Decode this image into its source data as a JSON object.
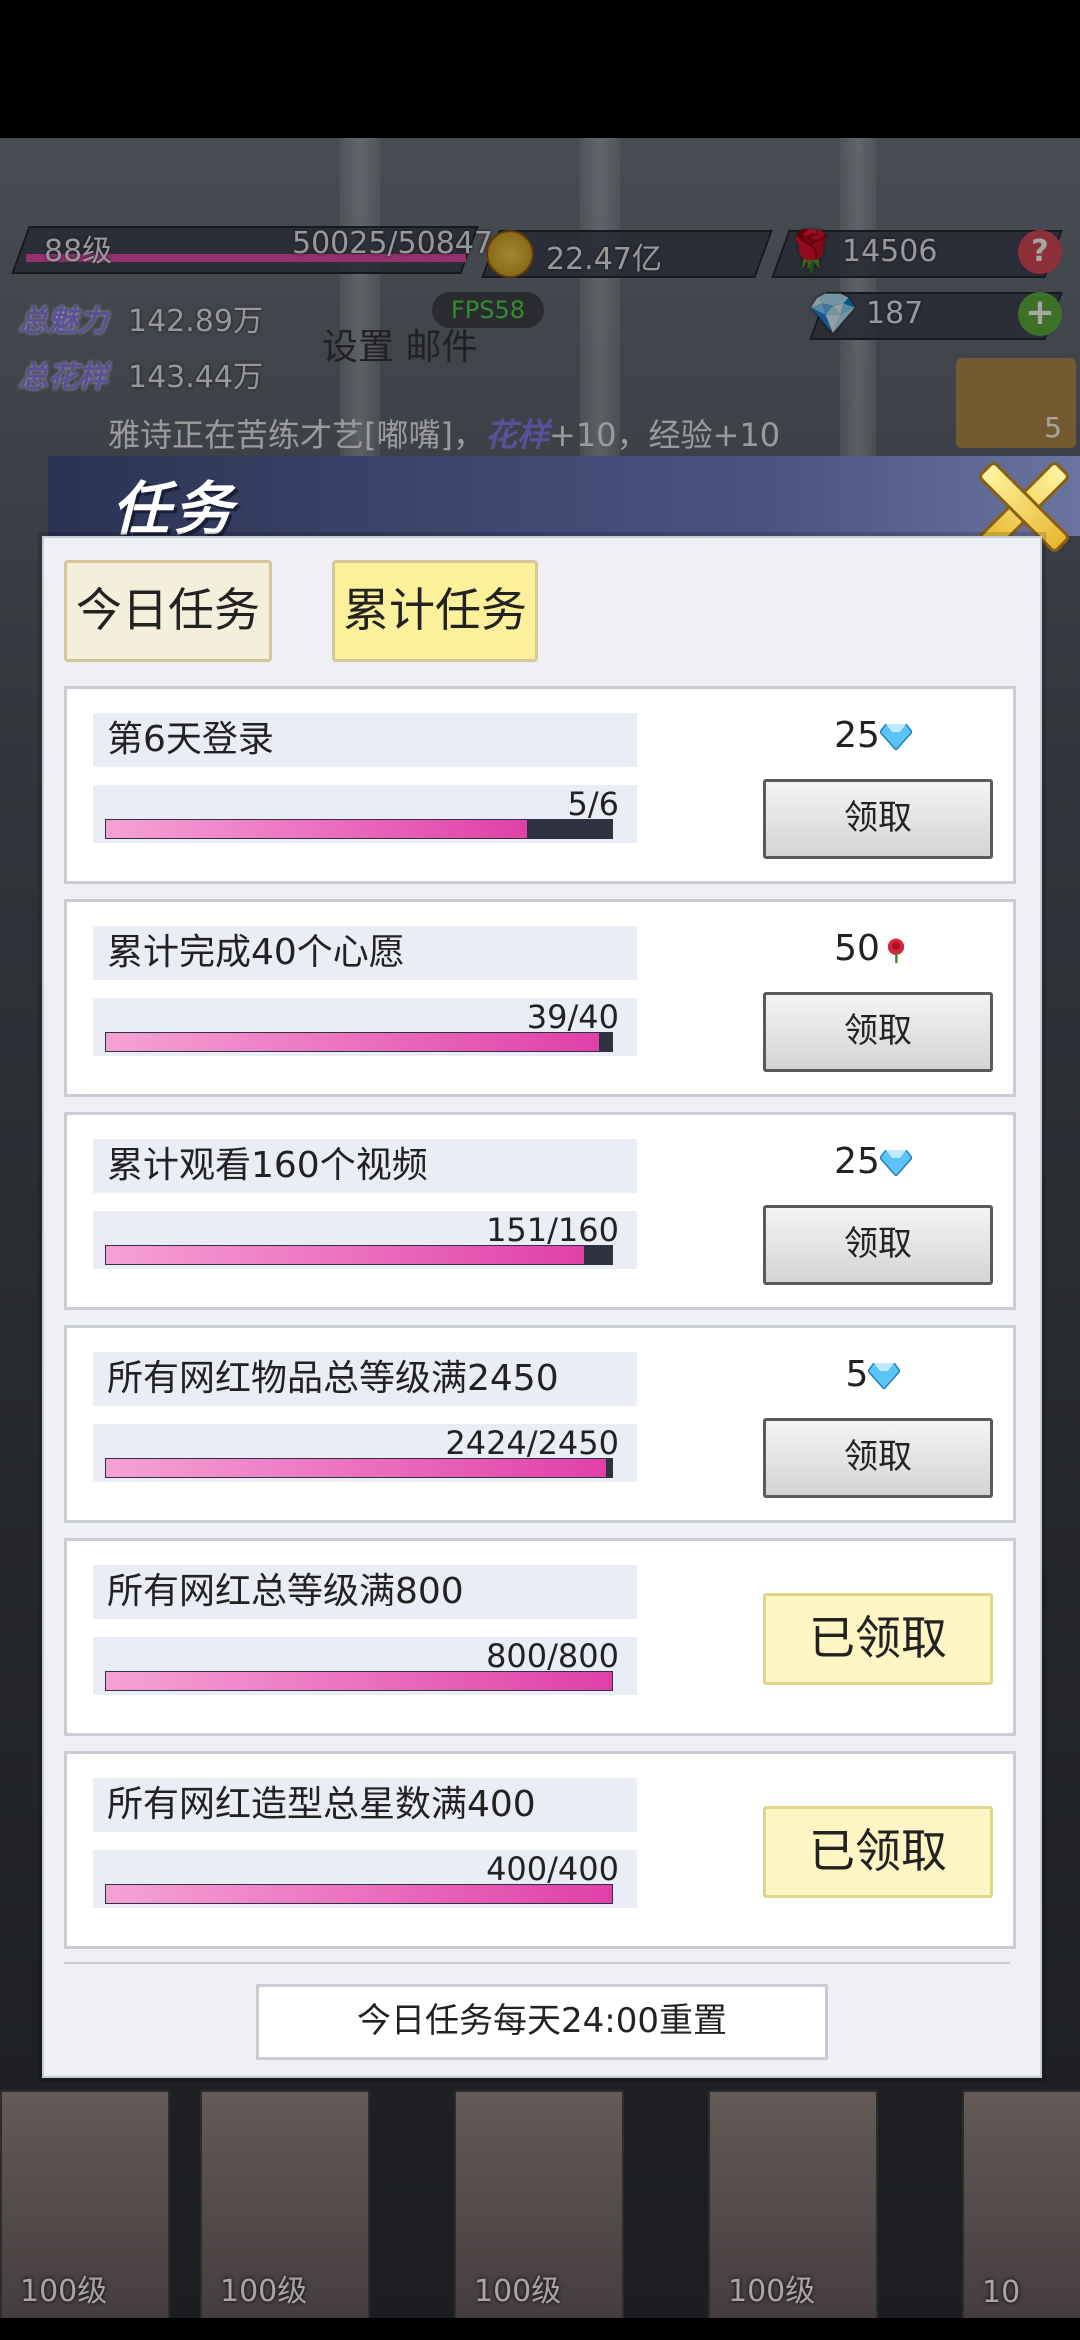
{
  "hud": {
    "level": "88级",
    "exp": "50025/50847",
    "exp_fraction": 0.98,
    "coins": "22.47亿",
    "roses": "14506",
    "diamonds": "187",
    "charm_label": "总魅力",
    "charm_value": "142.89万",
    "style_label": "总花样",
    "style_value": "143.44万",
    "settings_mail": "设置 邮件",
    "fps": "FPS58",
    "help_icon": "?",
    "plus_icon": "+",
    "ticker_prefix": "雅诗正在苦练才艺[嘟嘴]，",
    "ticker_highlight": "花样",
    "ticker_suffix": "+10，经验+10",
    "rank_badge": "5"
  },
  "panel": {
    "title": "任务",
    "tabs": [
      {
        "label": "今日任务",
        "active": false
      },
      {
        "label": "累计任务",
        "active": true
      }
    ],
    "tasks": [
      {
        "name": "第6天登录",
        "progress_text": "5/6",
        "progress": 0.833,
        "reward_amount": "25",
        "reward_icon": "diamond-icon",
        "status": "claimable",
        "button": "领取"
      },
      {
        "name": "累计完成40个心愿",
        "progress_text": "39/40",
        "progress": 0.975,
        "reward_amount": "50",
        "reward_icon": "rose-icon",
        "status": "claimable",
        "button": "领取"
      },
      {
        "name": "累计观看160个视频",
        "progress_text": "151/160",
        "progress": 0.944,
        "reward_amount": "25",
        "reward_icon": "diamond-icon",
        "status": "claimable",
        "button": "领取"
      },
      {
        "name": "所有网红物品总等级满2450",
        "progress_text": "2424/2450",
        "progress": 0.989,
        "reward_amount": "5",
        "reward_icon": "diamond-icon",
        "status": "claimable",
        "button": "领取"
      },
      {
        "name": "所有网红总等级满800",
        "progress_text": "800/800",
        "progress": 1.0,
        "status": "claimed",
        "button": "已领取"
      },
      {
        "name": "所有网红造型总星数满400",
        "progress_text": "400/400",
        "progress": 1.0,
        "status": "claimed",
        "button": "已领取"
      }
    ],
    "reset_note": "今日任务每天24:00重置"
  },
  "characters": [
    {
      "level": "100级"
    },
    {
      "level": "100级"
    },
    {
      "level": "100级"
    },
    {
      "level": "100级"
    },
    {
      "level": "10"
    }
  ],
  "colors": {
    "progress_fill": "#e040a8",
    "tab_active": "#fdf09a",
    "claimed_bg": "#fdf6c4",
    "hud_label": "#8a7be8"
  }
}
